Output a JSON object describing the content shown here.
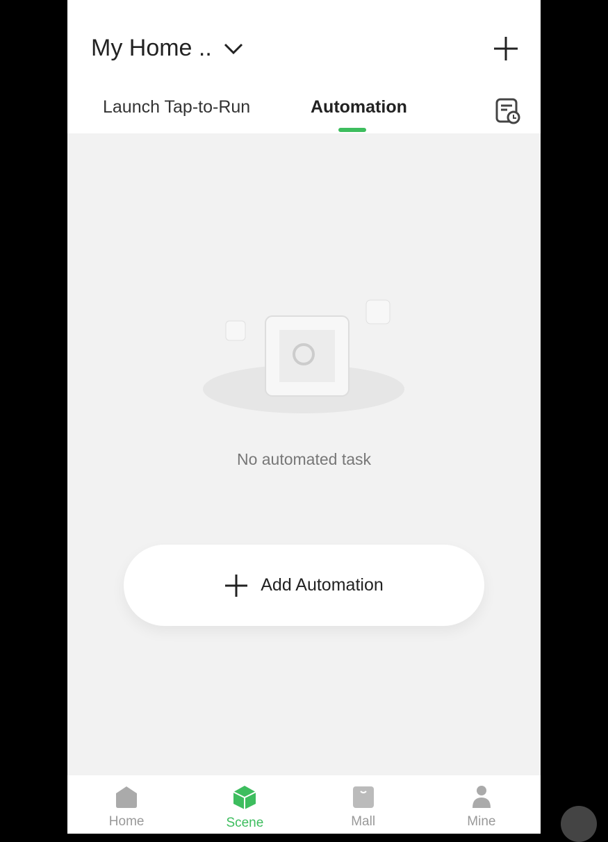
{
  "header": {
    "home_name": "My Home ..",
    "tabs": [
      {
        "label": "Launch Tap-to-Run"
      },
      {
        "label": "Automation"
      }
    ],
    "active_tab": "Automation"
  },
  "empty": {
    "message": "No automated task"
  },
  "add_automation": {
    "label": "Add Automation"
  },
  "nav": {
    "items": [
      {
        "label": "Home",
        "icon": "home-icon"
      },
      {
        "label": "Scene",
        "icon": "scene-icon"
      },
      {
        "label": "Mall",
        "icon": "mall-icon"
      },
      {
        "label": "Mine",
        "icon": "mine-icon"
      }
    ],
    "active": "Scene"
  },
  "colors": {
    "accent": "#3dbd5e"
  }
}
